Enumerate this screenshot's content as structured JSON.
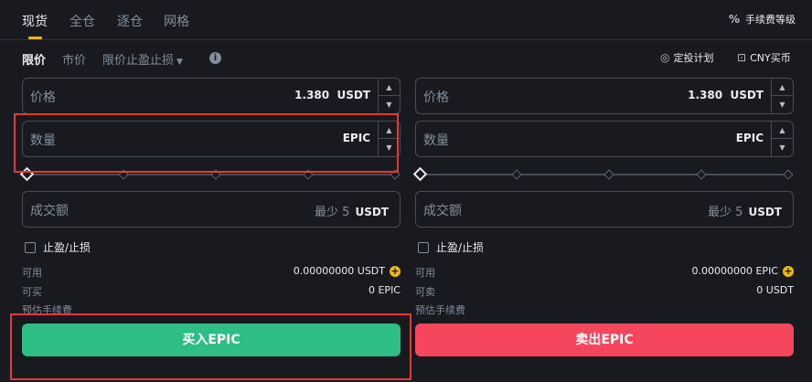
{
  "tabs": [
    "现货",
    "全仓",
    "逐仓",
    "网格"
  ],
  "fee_level": "手续费等级",
  "order_types": [
    "限价",
    "市价"
  ],
  "stop_limit": "限价止盈止损",
  "dca_plan": "定投计划",
  "cny_buy": "CNY买币",
  "buy": {
    "price_label": "价格",
    "price_value": "1.380",
    "price_unit": "USDT",
    "amount_label": "数量",
    "amount_unit": "EPIC",
    "total_label": "成交额",
    "total_placeholder": "最少 5",
    "total_unit": "USDT",
    "tpsl_label": "止盈/止损",
    "available_label": "可用",
    "available_value": "0.00000000 USDT",
    "max_label": "可买",
    "max_value": "0 EPIC",
    "fee_label": "预估手续费",
    "button_label": "买入EPIC",
    "slider_value": 0
  },
  "sell": {
    "price_label": "价格",
    "price_value": "1.380",
    "price_unit": "USDT",
    "amount_label": "数量",
    "amount_unit": "EPIC",
    "total_label": "成交额",
    "total_placeholder": "最少 5",
    "total_unit": "USDT",
    "tpsl_label": "止盈/止损",
    "available_label": "可用",
    "available_value": "0.00000000 EPIC",
    "max_label": "可卖",
    "max_value": "0 USDT",
    "fee_label": "预估手续费",
    "button_label": "卖出EPIC",
    "slider_value": 0
  },
  "colors": {
    "background": "#181a20",
    "accent": "#f0b90b",
    "buy": "#2ebd85",
    "sell": "#f6465d",
    "highlight": "#e53935"
  }
}
